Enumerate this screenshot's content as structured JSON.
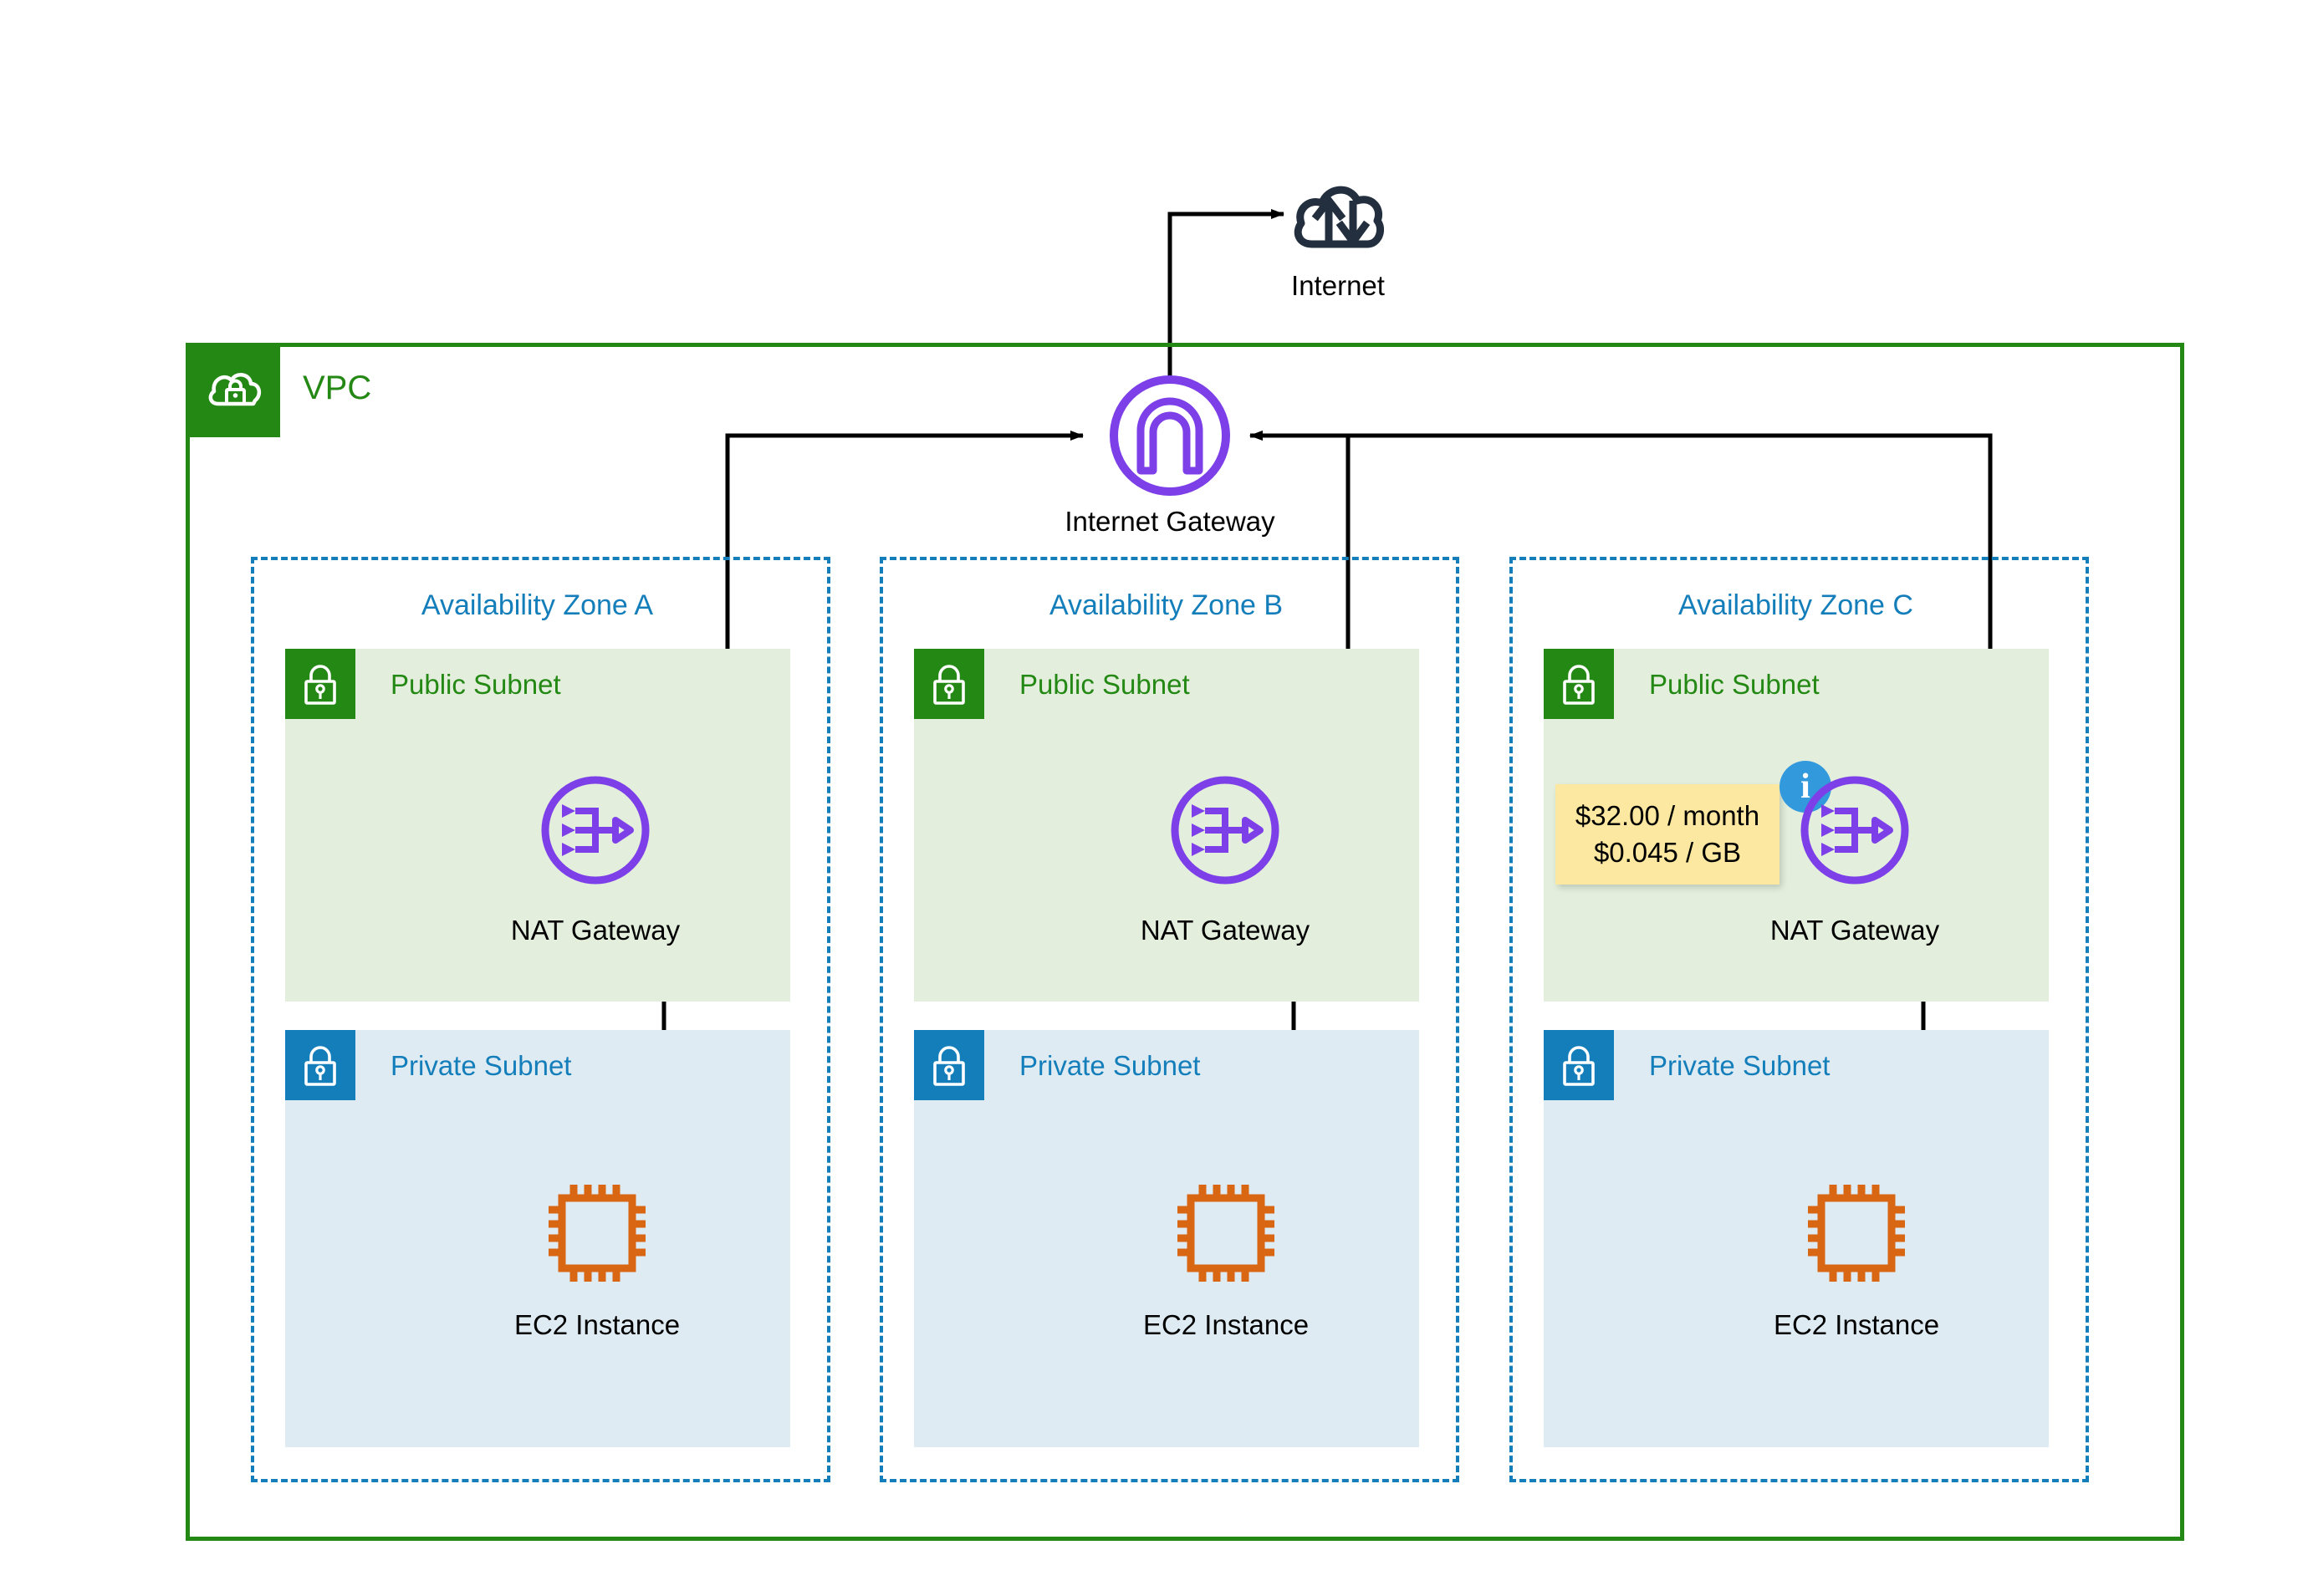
{
  "diagram": {
    "title": "AWS VPC multi-AZ NAT Gateway architecture",
    "colors": {
      "vpc_green": "#248814",
      "subnet_public_fill": "#E3EFDC",
      "subnet_private_fill": "#DEEBF3",
      "az_blue": "#147EBA",
      "gateway_purple": "#7D3FE8",
      "ec2_orange": "#D86613",
      "internet_navy": "#232F3E",
      "tooltip_yellow": "#FCE8A0",
      "info_blue": "#3399DD",
      "wire_black": "#000000"
    }
  },
  "internet": {
    "label": "Internet",
    "icon": "internet-cloud-icon"
  },
  "vpc": {
    "label": "VPC",
    "icon": "vpc-cloud-lock-icon"
  },
  "internet_gateway": {
    "label": "Internet Gateway",
    "icon": "internet-gateway-icon"
  },
  "availability_zones": [
    {
      "label": "Availability Zone A",
      "public_subnet": {
        "label": "Public Subnet",
        "icon": "padlock-icon",
        "node": {
          "label": "NAT Gateway",
          "icon": "nat-gateway-icon"
        }
      },
      "private_subnet": {
        "label": "Private Subnet",
        "icon": "padlock-icon",
        "node": {
          "label": "EC2 Instance",
          "icon": "ec2-chip-icon"
        }
      }
    },
    {
      "label": "Availability Zone B",
      "public_subnet": {
        "label": "Public Subnet",
        "icon": "padlock-icon",
        "node": {
          "label": "NAT Gateway",
          "icon": "nat-gateway-icon"
        }
      },
      "private_subnet": {
        "label": "Private Subnet",
        "icon": "padlock-icon",
        "node": {
          "label": "EC2 Instance",
          "icon": "ec2-chip-icon"
        }
      }
    },
    {
      "label": "Availability Zone C",
      "public_subnet": {
        "label": "Public Subnet",
        "icon": "padlock-icon",
        "node": {
          "label": "NAT Gateway",
          "icon": "nat-gateway-icon"
        }
      },
      "private_subnet": {
        "label": "Private Subnet",
        "icon": "padlock-icon",
        "node": {
          "label": "EC2 Instance",
          "icon": "ec2-chip-icon"
        }
      }
    }
  ],
  "cost_tooltip": {
    "icon": "info-icon",
    "info_glyph": "i",
    "line1": "$32.00 / month",
    "line2": "$0.045 / GB"
  }
}
